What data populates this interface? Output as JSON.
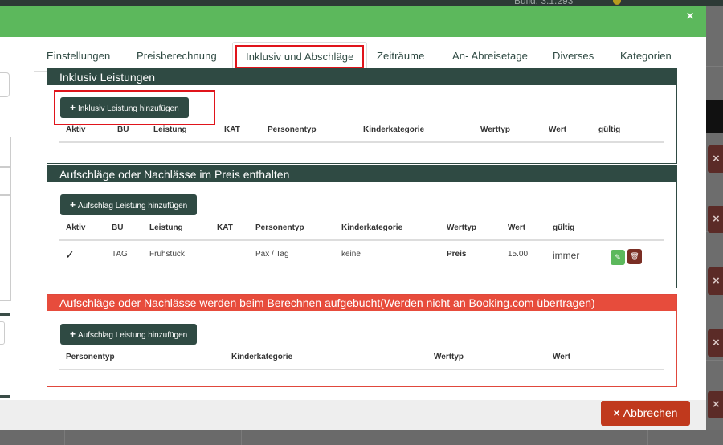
{
  "background": {
    "build_text": "Build: 3.1.293",
    "delete_icon": "×"
  },
  "modal": {
    "close_icon": "×"
  },
  "tabs": [
    {
      "label": "Einstellungen"
    },
    {
      "label": "Preisberechnung"
    },
    {
      "label": "Inklusiv und Abschläge"
    },
    {
      "label": "Zeiträume"
    },
    {
      "label": "An- Abreisetage"
    },
    {
      "label": "Diverses"
    },
    {
      "label": "Kategorien"
    }
  ],
  "active_tab": "Inklusiv und Abschläge",
  "inklusiv": {
    "title": "Inklusiv Leistungen",
    "add_button": "Inklusiv Leistung hinzufügen",
    "columns": [
      "Aktiv",
      "BU",
      "Leistung",
      "KAT",
      "Personentyp",
      "Kinderkategorie",
      "Werttyp",
      "Wert",
      "gültig"
    ],
    "rows": []
  },
  "aufschlaege_enthalten": {
    "title": "Aufschläge oder Nachlässe im Preis enthalten",
    "add_button": "Aufschlag Leistung hinzufügen",
    "columns": [
      "Aktiv",
      "BU",
      "Leistung",
      "KAT",
      "Personentyp",
      "Kinderkategorie",
      "Werttyp",
      "Wert",
      "gültig"
    ],
    "rows": [
      {
        "aktiv": "✓",
        "bu": "TAG",
        "leistung": "Frühstück",
        "kat": "",
        "personentyp": "Pax / Tag",
        "kinderkategorie": "keine",
        "werttyp": "Preis",
        "wert": "15.00",
        "gueltig": "immer"
      }
    ]
  },
  "aufschlaege_aufgebucht": {
    "title": "Aufschläge oder Nachlässe werden beim Berechnen aufgebucht(Werden nicht an Booking.com übertragen)",
    "add_button": "Aufschlag Leistung hinzufügen",
    "columns": [
      "Personentyp",
      "Kinderkategorie",
      "Werttyp",
      "Wert"
    ],
    "rows": []
  },
  "footer": {
    "cancel_label": "Abbrechen",
    "cancel_icon": "×"
  },
  "icons": {
    "plus": "+",
    "edit": "✎",
    "delete": "🗑"
  },
  "colors": {
    "header_green": "#5cb85c",
    "panel_dark": "#2f4a43",
    "panel_red": "#e74c3c",
    "cancel_red": "#c0391d",
    "highlight_red": "#e0141b"
  }
}
